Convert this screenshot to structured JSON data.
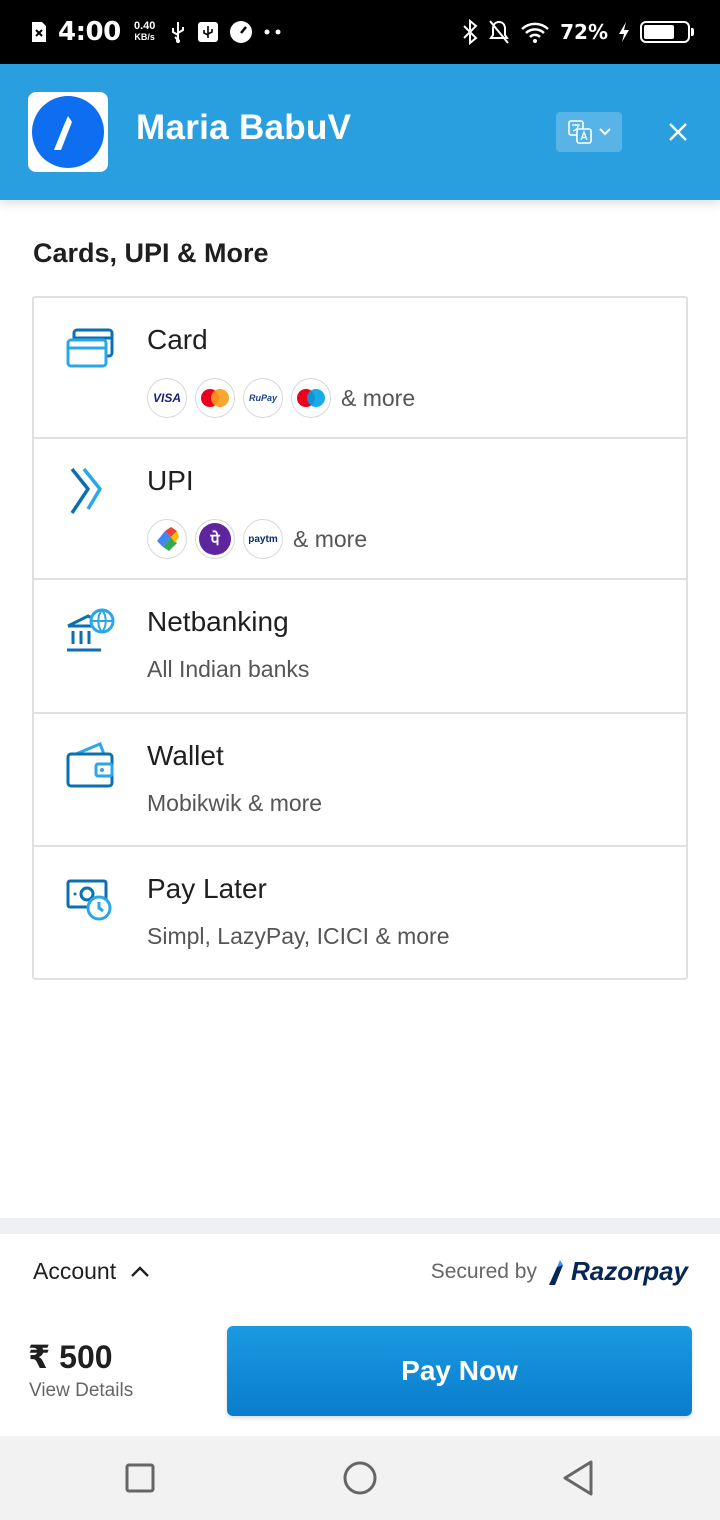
{
  "status_bar": {
    "time": "4:00",
    "speed_value": "0.40",
    "speed_unit": "KB/s",
    "battery_percent": "72%",
    "battery_level": 0.72
  },
  "header": {
    "merchant_name": "Maria BabuV",
    "accent_color": "#2a9fdf"
  },
  "section": {
    "title": "Cards, UPI & More"
  },
  "methods": {
    "card": {
      "title": "Card",
      "more": "& more",
      "badges": [
        "VISA",
        "mastercard",
        "RuPay",
        "maestro"
      ]
    },
    "upi": {
      "title": "UPI",
      "more": "& more",
      "badges": [
        "google-pay",
        "phonepe",
        "paytm"
      ],
      "phonepe_glyph": "पे",
      "paytm_label": "paytm"
    },
    "netbanking": {
      "title": "Netbanking",
      "subtitle": "All Indian banks"
    },
    "wallet": {
      "title": "Wallet",
      "subtitle": "Mobikwik & more"
    },
    "paylater": {
      "title": "Pay Later",
      "subtitle": "Simpl, LazyPay, ICICI & more"
    }
  },
  "footer": {
    "account_label": "Account",
    "secured_by": "Secured by",
    "brand": "Razorpay",
    "amount": "₹ 500",
    "view_details": "View Details",
    "pay_button": "Pay Now"
  },
  "nav": {
    "icons": [
      "recents-square-icon",
      "home-circle-icon",
      "back-triangle-icon"
    ]
  }
}
